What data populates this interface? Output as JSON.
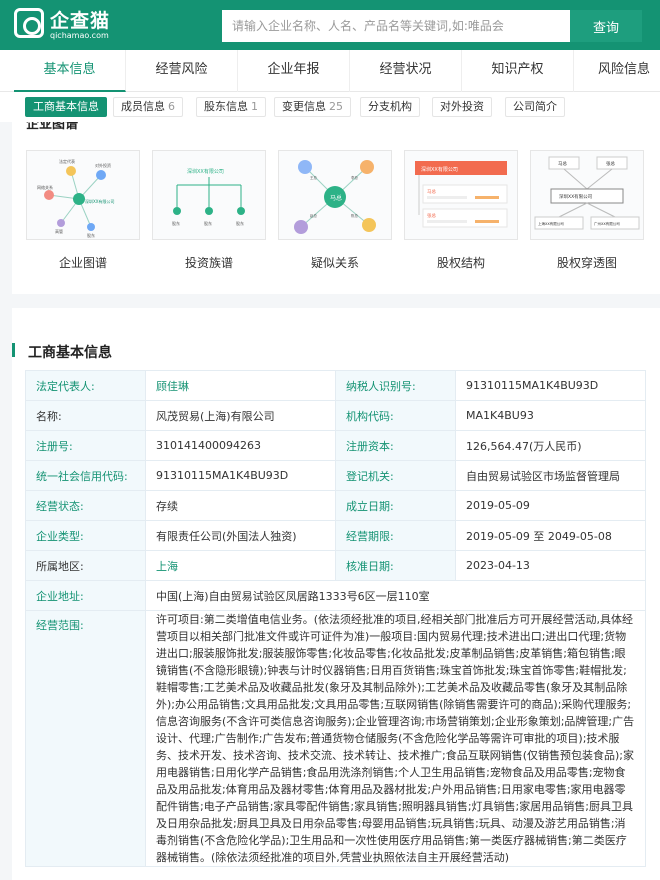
{
  "header": {
    "logo_text": "企查猫",
    "logo_sub": "qichamao.com",
    "search_placeholder": "请输入企业名称、人名、产品名等关键词,如:唯品会",
    "search_button": "查询"
  },
  "main_tabs": [
    "基本信息",
    "经营风险",
    "企业年报",
    "经营状况",
    "知识产权",
    "风险信息"
  ],
  "sub_tabs": [
    {
      "label": "工商基本信息",
      "count": ""
    },
    {
      "label": "成员信息",
      "count": "6"
    },
    {
      "label": "股东信息",
      "count": "1"
    },
    {
      "label": "变更信息",
      "count": "25"
    },
    {
      "label": "分支机构",
      "count": ""
    },
    {
      "label": "对外投资",
      "count": ""
    },
    {
      "label": "公司简介",
      "count": ""
    }
  ],
  "graph_section": {
    "title": "企业图谱",
    "items": [
      {
        "label": "企业图谱",
        "center_name": "深圳XX有限公司",
        "nodes": [
          "法定代表",
          "对外投资",
          "网络关系",
          "高管",
          "股东"
        ]
      },
      {
        "label": "投资族谱",
        "company": "深圳XX有限公司",
        "nodes": [
          "股东",
          "股东",
          "股东"
        ]
      },
      {
        "label": "疑似关系",
        "center": "马总",
        "nodes": [
          "王总",
          "李总",
          "赵总",
          "陈总"
        ]
      },
      {
        "label": "股权结构",
        "company": "深圳XX有限公司",
        "rows": [
          "马总",
          "张总"
        ]
      },
      {
        "label": "股权穿透图",
        "top": [
          "马总",
          "张总"
        ],
        "company": "深圳XX有限公司",
        "subs": [
          "上海XX有限公司",
          "广州XX有限公司"
        ]
      }
    ]
  },
  "info_section": {
    "title": "工商基本信息",
    "legal_rep_label": "法定代表人:",
    "legal_rep": "顾佳琳",
    "taxpayer_label": "纳税人识别号:",
    "taxpayer": "91310115MA1K4BU93D",
    "name_label": "名称:",
    "name": "风茂贸易(上海)有限公司",
    "org_code_label": "机构代码:",
    "org_code": "MA1K4BU93",
    "reg_no_label": "注册号:",
    "reg_no": "310141400094263",
    "capital_label": "注册资本:",
    "capital": "126,564.47(万人民币)",
    "credit_code_label": "统一社会信用代码:",
    "credit_code": "91310115MA1K4BU93D",
    "authority_label": "登记机关:",
    "authority": "自由贸易试验区市场监督管理局",
    "status_label": "经营状态:",
    "status": "存续",
    "found_label": "成立日期:",
    "found": "2019-05-09",
    "type_label": "企业类型:",
    "type": "有限责任公司(外国法人独资)",
    "term_label": "经营期限:",
    "term": "2019-05-09 至 2049-05-08",
    "region_label": "所属地区:",
    "region": "上海",
    "approval_label": "核准日期:",
    "approval": "2023-04-13",
    "address_label": "企业地址:",
    "address": "中国(上海)自由贸易试验区凤居路1333号6区一层110室",
    "scope_label": "经营范围:",
    "scope": "许可项目:第二类增值电信业务。(依法须经批准的项目,经相关部门批准后方可开展经营活动,具体经营项目以相关部门批准文件或许可证件为准)一般项目:国内贸易代理;技术进出口;进出口代理;货物进出口;服装服饰批发;服装服饰零售;化妆品零售;化妆品批发;皮革制品销售;皮革销售;箱包销售;眼镜销售(不含隐形眼镜);钟表与计时仪器销售;日用百货销售;珠宝首饰批发;珠宝首饰零售;鞋帽批发;鞋帽零售;工艺美术品及收藏品批发(象牙及其制品除外);工艺美术品及收藏品零售(象牙及其制品除外);办公用品销售;文具用品批发;文具用品零售;互联网销售(除销售需要许可的商品);采购代理服务;信息咨询服务(不含许可类信息咨询服务);企业管理咨询;市场营销策划;企业形象策划;品牌管理;广告设计、代理;广告制作;广告发布;普通货物仓储服务(不含危险化学品等需许可审批的项目);技术服务、技术开发、技术咨询、技术交流、技术转让、技术推广;食品互联网销售(仅销售预包装食品);家用电器销售;日用化学产品销售;食品用洗涤剂销售;个人卫生用品销售;宠物食品及用品零售;宠物食品及用品批发;体育用品及器材零售;体育用品及器材批发;户外用品销售;日用家电零售;家用电器零配件销售;电子产品销售;家具零配件销售;家具销售;照明器具销售;灯具销售;家居用品销售;厨具卫具及日用杂品批发;厨具卫具及日用杂品零售;母婴用品销售;玩具销售;玩具、动漫及游艺用品销售;消毒剂销售(不含危险化学品);卫生用品和一次性使用医疗用品销售;第一类医疗器械销售;第二类医疗器械销售。(除依法须经批准的项目外,凭营业执照依法自主开展经营活动)"
  },
  "colors": {
    "brand": "#149373",
    "label_bg": "#f2f9fc"
  }
}
